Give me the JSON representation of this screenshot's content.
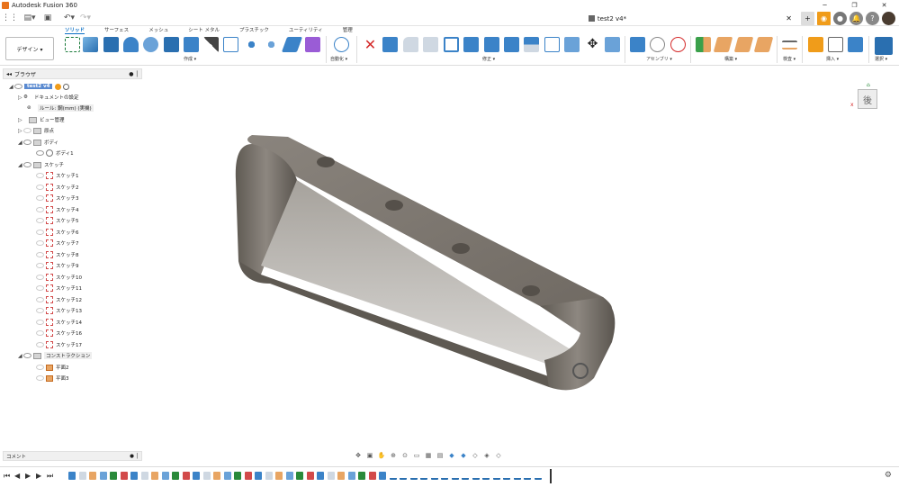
{
  "window": {
    "title": "Autodesk Fusion 360",
    "doc_title": "test2 v4*"
  },
  "tabs": [
    {
      "label": "ソリッド",
      "active": true
    },
    {
      "label": "サーフェス"
    },
    {
      "label": "メッシュ"
    },
    {
      "label": "シート メタル"
    },
    {
      "label": "プラスチック"
    },
    {
      "label": "ユーティリティ"
    },
    {
      "label": "管理"
    }
  ],
  "ribbon": {
    "design_label": "デザイン ▾",
    "groups": [
      {
        "label": "作成 ▾"
      },
      {
        "label": "自動化 ▾"
      },
      {
        "label": "修正 ▾"
      },
      {
        "label": "アセンブリ ▾"
      },
      {
        "label": "構築 ▾"
      },
      {
        "label": "検査 ▾"
      },
      {
        "label": "挿入 ▾"
      },
      {
        "label": "選択 ▾"
      }
    ]
  },
  "browser": {
    "title": "ブラウザ",
    "root": "test2 v4",
    "items": [
      {
        "label": "ドキュメントの設定"
      },
      {
        "label": "ルール: 鋼(mm) (実機)"
      },
      {
        "label": "ビュー管理"
      },
      {
        "label": "原点"
      },
      {
        "label": "ボディ"
      },
      {
        "label": "ボディ1"
      },
      {
        "label": "スケッチ"
      },
      {
        "label": "スケッチ1"
      },
      {
        "label": "スケッチ2"
      },
      {
        "label": "スケッチ3"
      },
      {
        "label": "スケッチ4"
      },
      {
        "label": "スケッチ5"
      },
      {
        "label": "スケッチ6"
      },
      {
        "label": "スケッチ7"
      },
      {
        "label": "スケッチ8"
      },
      {
        "label": "スケッチ9"
      },
      {
        "label": "スケッチ10"
      },
      {
        "label": "スケッチ11"
      },
      {
        "label": "スケッチ12"
      },
      {
        "label": "スケッチ13"
      },
      {
        "label": "スケッチ14"
      },
      {
        "label": "スケッチ16"
      },
      {
        "label": "スケッチ17"
      },
      {
        "label": "コンストラクション"
      },
      {
        "label": "平面2"
      },
      {
        "label": "平面3"
      }
    ]
  },
  "comment": {
    "label": "コメント"
  },
  "viewcube": {
    "face": "後"
  },
  "colors": {
    "accent": "#0a6fc4",
    "orange": "#f09c1a",
    "model": "#7d766d"
  }
}
